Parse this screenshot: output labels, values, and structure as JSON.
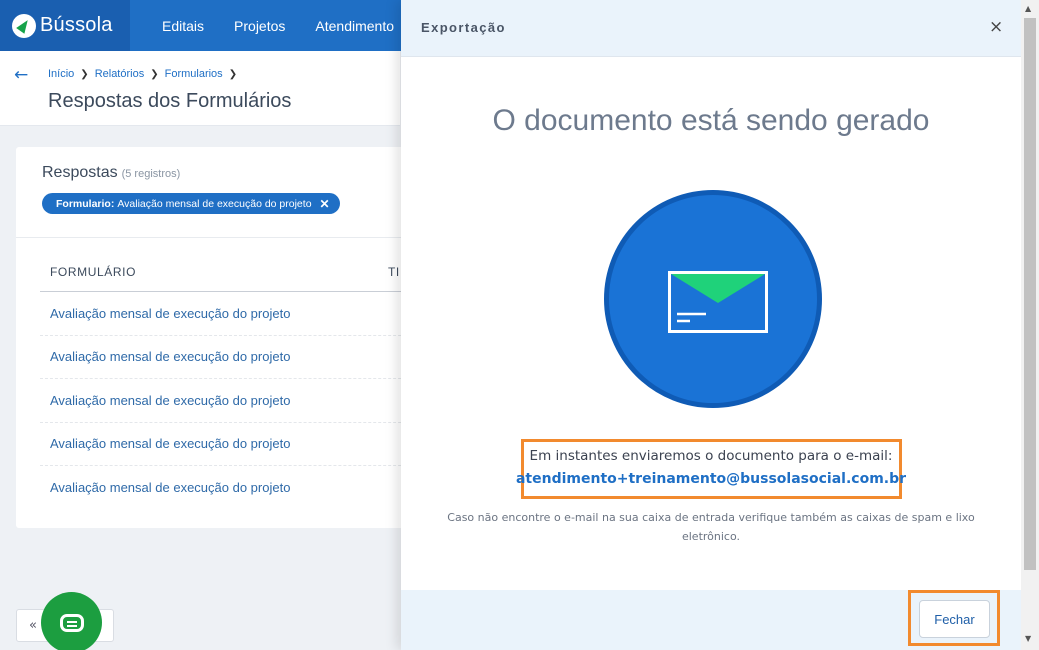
{
  "topnav": {
    "logo_text": "Bússola",
    "items": [
      "Editais",
      "Projetos",
      "Atendimento"
    ]
  },
  "page": {
    "back_icon": "arrow-left-icon",
    "breadcrumb": [
      "Início",
      "Relatórios",
      "Formularios"
    ],
    "title": "Respostas dos Formulários"
  },
  "responses": {
    "title": "Respostas",
    "count": "(5 registros)",
    "filter_label": "Formulario:",
    "filter_value": "Avaliação mensal de execução do projeto",
    "filter_remove": "✕",
    "col_form": "FORMULÁRIO",
    "col_second": "TI",
    "rows": [
      "Avaliação mensal de execução do projeto",
      "Avaliação mensal de execução do projeto",
      "Avaliação mensal de execução do projeto",
      "Avaliação mensal de execução do projeto",
      "Avaliação mensal de execução do projeto"
    ]
  },
  "pager": {
    "prev": "«"
  },
  "export": {
    "title": "Exportação",
    "close": "×",
    "headline": "O documento está sendo gerado",
    "message": "Em instantes enviaremos o documento para o e-mail:",
    "email": "atendimento+treinamento@bussolasocial.com.br",
    "hint": "Caso não encontre o e-mail na sua caixa de entrada verifique também as caixas de spam e lixo eletrônico.",
    "close_button": "Fechar"
  },
  "colors": {
    "brand_blue": "#1f6fc5",
    "highlight_orange": "#f28a2e",
    "chat_green": "#1c9e40",
    "envelope_flap": "#1fd27a"
  }
}
